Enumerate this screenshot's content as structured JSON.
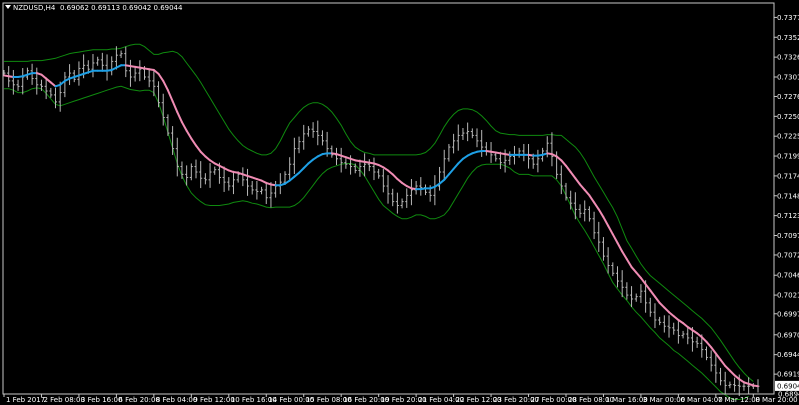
{
  "window": {
    "symbol_label": "NZDUSD,H4",
    "ohlc_label": "0.69062 0.69113 0.69042 0.69044"
  },
  "chart_data": {
    "type": "candlestick",
    "ylim": [
      0.6894,
      0.7396
    ],
    "y_ticks": [
      0.73775,
      0.7352,
      0.73265,
      0.7301,
      0.7276,
      0.72505,
      0.7225,
      0.71995,
      0.7174,
      0.71485,
      0.7123,
      0.70975,
      0.70725,
      0.70465,
      0.7021,
      0.6997,
      0.697,
      0.69445,
      0.69195
    ],
    "current_price": 0.69044,
    "marker_price": 0.6894,
    "x_labels": [
      "1 Feb 2017",
      "2 Feb 08:00",
      "3 Feb 16:00",
      "6 Feb 20:00",
      "8 Feb 04:00",
      "9 Feb 12:00",
      "10 Feb 16:00",
      "14 Feb 00:00",
      "15 Feb 08:00",
      "16 Feb 20:00",
      "19 Feb 20:00",
      "21 Feb 04:00",
      "22 Feb 12:00",
      "23 Feb 20:00",
      "27 Feb 00:00",
      "28 Feb 08:00",
      "1 Mar 16:00",
      "3 Mar 00:00",
      "6 Mar 04:00",
      "7 Mar 12:00",
      "8 Mar 20:00"
    ],
    "x_label_bars": [
      0,
      8,
      16,
      24,
      32,
      40,
      48,
      56,
      64,
      72,
      80,
      88,
      96,
      104,
      112,
      120,
      128,
      136,
      144,
      152,
      160
    ],
    "close": [
      0.7306,
      0.7296,
      0.7291,
      0.7289,
      0.7301,
      0.7309,
      0.7299,
      0.7291,
      0.7289,
      0.7283,
      0.7278,
      0.7269,
      0.7281,
      0.7301,
      0.7306,
      0.7298,
      0.7312,
      0.7316,
      0.7311,
      0.7319,
      0.7323,
      0.7316,
      0.7309,
      0.7321,
      0.7329,
      0.7331,
      0.7309,
      0.7301,
      0.7306,
      0.7311,
      0.7301,
      0.7296,
      0.7289,
      0.7268,
      0.7249,
      0.7229,
      0.7209,
      0.7186,
      0.7176,
      0.7172,
      0.7186,
      0.7179,
      0.7171,
      0.7169,
      0.7179,
      0.7182,
      0.7172,
      0.7166,
      0.7161,
      0.7169,
      0.7176,
      0.7169,
      0.7161,
      0.7156,
      0.7154,
      0.7156,
      0.7146,
      0.7152,
      0.7161,
      0.7166,
      0.7176,
      0.7189,
      0.7209,
      0.7218,
      0.7228,
      0.7234,
      0.7231,
      0.7226,
      0.7219,
      0.7209,
      0.7201,
      0.7196,
      0.7191,
      0.7189,
      0.7186,
      0.7181,
      0.7186,
      0.7189,
      0.7186,
      0.7179,
      0.7174,
      0.7161,
      0.7151,
      0.7141,
      0.7136,
      0.7141,
      0.7149,
      0.7156,
      0.7161,
      0.7159,
      0.7153,
      0.7149,
      0.7161,
      0.7179,
      0.7196,
      0.7211,
      0.7219,
      0.7226,
      0.7229,
      0.7231,
      0.7226,
      0.7219,
      0.7211,
      0.7206,
      0.7201,
      0.7196,
      0.7191,
      0.7194,
      0.7199,
      0.7201,
      0.7206,
      0.7201,
      0.7196,
      0.7189,
      0.7196,
      0.7206,
      0.7216,
      0.7199,
      0.7176,
      0.7161,
      0.7146,
      0.7139,
      0.7131,
      0.7126,
      0.7131,
      0.7119,
      0.7101,
      0.7089,
      0.7071,
      0.7059,
      0.7049,
      0.7039,
      0.7031,
      0.7021,
      0.7016,
      0.7019,
      0.7026,
      0.7011,
      0.6999,
      0.6989,
      0.6986,
      0.6981,
      0.6979,
      0.6976,
      0.6969,
      0.6971,
      0.6966,
      0.6961,
      0.6959,
      0.6951,
      0.6941,
      0.6931,
      0.6921,
      0.6911,
      0.6905,
      0.6906,
      0.6905,
      0.6904,
      0.6904,
      0.6904,
      0.6904,
      0.6904
    ],
    "ma": [
      0.7303,
      0.7302,
      0.7301,
      0.7301,
      0.7302,
      0.7304,
      0.7306,
      0.7306,
      0.7304,
      0.7299,
      0.7294,
      0.7289,
      0.7291,
      0.7296,
      0.7299,
      0.7301,
      0.7303,
      0.7305,
      0.7307,
      0.7309,
      0.7309,
      0.7309,
      0.7309,
      0.731,
      0.7313,
      0.7316,
      0.7316,
      0.7315,
      0.7314,
      0.7313,
      0.7312,
      0.7311,
      0.731,
      0.7305,
      0.7296,
      0.7284,
      0.727,
      0.7256,
      0.7243,
      0.7232,
      0.7222,
      0.7213,
      0.7205,
      0.7199,
      0.7194,
      0.719,
      0.7187,
      0.7184,
      0.7181,
      0.7179,
      0.7178,
      0.7176,
      0.7174,
      0.7172,
      0.717,
      0.7168,
      0.7165,
      0.7163,
      0.7162,
      0.7162,
      0.7164,
      0.7168,
      0.7173,
      0.7178,
      0.7184,
      0.719,
      0.7195,
      0.7199,
      0.7202,
      0.7203,
      0.7203,
      0.7202,
      0.72,
      0.7198,
      0.7196,
      0.7194,
      0.7193,
      0.7192,
      0.7191,
      0.719,
      0.7188,
      0.7185,
      0.7181,
      0.7176,
      0.717,
      0.7165,
      0.7161,
      0.7158,
      0.7157,
      0.7157,
      0.7158,
      0.7158,
      0.716,
      0.7164,
      0.7169,
      0.7176,
      0.7183,
      0.719,
      0.7196,
      0.72,
      0.7203,
      0.7205,
      0.7206,
      0.7206,
      0.7205,
      0.7204,
      0.7203,
      0.7202,
      0.7201,
      0.7201,
      0.7201,
      0.7201,
      0.7201,
      0.72,
      0.72,
      0.7201,
      0.7203,
      0.7202,
      0.7199,
      0.7194,
      0.7187,
      0.7179,
      0.7171,
      0.7163,
      0.7156,
      0.7149,
      0.714,
      0.7131,
      0.7121,
      0.711,
      0.7099,
      0.7088,
      0.7077,
      0.7067,
      0.7057,
      0.705,
      0.7043,
      0.7035,
      0.7027,
      0.7019,
      0.7011,
      0.7005,
      0.6999,
      0.6994,
      0.6989,
      0.6985,
      0.698,
      0.6976,
      0.6972,
      0.6967,
      0.6961,
      0.6954,
      0.6946,
      0.6938,
      0.693,
      0.6924,
      0.6918,
      0.6913,
      0.6909,
      0.6907,
      0.6905,
      0.6904
    ],
    "upper_band": [
      0.7321,
      0.7321,
      0.7321,
      0.7321,
      0.7321,
      0.7321,
      0.7322,
      0.7322,
      0.7322,
      0.7323,
      0.7324,
      0.7325,
      0.7327,
      0.7329,
      0.7331,
      0.7332,
      0.7333,
      0.7334,
      0.7335,
      0.7336,
      0.7336,
      0.7336,
      0.7336,
      0.7337,
      0.7337,
      0.7338,
      0.734,
      0.7342,
      0.7343,
      0.7343,
      0.734,
      0.7335,
      0.733,
      0.733,
      0.7332,
      0.7333,
      0.7334,
      0.7332,
      0.7327,
      0.7319,
      0.7311,
      0.7303,
      0.7294,
      0.7284,
      0.7274,
      0.7264,
      0.7254,
      0.7244,
      0.7234,
      0.7226,
      0.7219,
      0.7213,
      0.7209,
      0.7206,
      0.7203,
      0.7201,
      0.7201,
      0.7203,
      0.7209,
      0.7219,
      0.7231,
      0.7242,
      0.7249,
      0.7256,
      0.7262,
      0.7266,
      0.7268,
      0.7268,
      0.7266,
      0.7262,
      0.7256,
      0.7248,
      0.7239,
      0.7228,
      0.7218,
      0.7211,
      0.7207,
      0.7204,
      0.7203,
      0.7201,
      0.7201,
      0.7201,
      0.7201,
      0.7201,
      0.7201,
      0.7201,
      0.7201,
      0.7201,
      0.7201,
      0.7202,
      0.7204,
      0.7209,
      0.7216,
      0.7226,
      0.7237,
      0.7246,
      0.7253,
      0.7258,
      0.726,
      0.726,
      0.7259,
      0.7256,
      0.7251,
      0.7245,
      0.7238,
      0.7232,
      0.7229,
      0.7228,
      0.7227,
      0.7227,
      0.7226,
      0.7226,
      0.7226,
      0.7226,
      0.7226,
      0.7226,
      0.7227,
      0.7227,
      0.7226,
      0.7226,
      0.7221,
      0.7216,
      0.7211,
      0.7204,
      0.7195,
      0.7184,
      0.7173,
      0.7163,
      0.7153,
      0.7143,
      0.7133,
      0.7121,
      0.7106,
      0.7091,
      0.7081,
      0.7071,
      0.7061,
      0.7053,
      0.7046,
      0.7041,
      0.7036,
      0.7031,
      0.7026,
      0.7021,
      0.7016,
      0.7011,
      0.7006,
      0.7001,
      0.6996,
      0.6991,
      0.6985,
      0.6979,
      0.6971,
      0.6963,
      0.6954,
      0.6945,
      0.6936,
      0.6928,
      0.6921,
      0.6915,
      0.691
    ],
    "lower_band": [
      0.7286,
      0.7286,
      0.7284,
      0.7281,
      0.7281,
      0.7283,
      0.7286,
      0.7287,
      0.7286,
      0.728,
      0.7273,
      0.7266,
      0.7264,
      0.7266,
      0.7268,
      0.727,
      0.7272,
      0.7274,
      0.7276,
      0.7278,
      0.728,
      0.7282,
      0.7284,
      0.7286,
      0.7288,
      0.7289,
      0.7287,
      0.7285,
      0.7284,
      0.7283,
      0.7284,
      0.7284,
      0.7281,
      0.7268,
      0.725,
      0.723,
      0.721,
      0.719,
      0.7174,
      0.7162,
      0.7152,
      0.7146,
      0.7141,
      0.7137,
      0.7136,
      0.7136,
      0.7136,
      0.7137,
      0.7138,
      0.714,
      0.7141,
      0.7142,
      0.7141,
      0.7139,
      0.7138,
      0.7136,
      0.7134,
      0.7133,
      0.7134,
      0.7134,
      0.7134,
      0.7134,
      0.7136,
      0.714,
      0.7146,
      0.7154,
      0.7162,
      0.717,
      0.7177,
      0.7182,
      0.7185,
      0.7187,
      0.7189,
      0.719,
      0.719,
      0.7188,
      0.7182,
      0.7174,
      0.7164,
      0.7154,
      0.7144,
      0.7136,
      0.7131,
      0.7126,
      0.7122,
      0.7119,
      0.7119,
      0.7121,
      0.7124,
      0.7124,
      0.7122,
      0.7119,
      0.7119,
      0.7121,
      0.7124,
      0.7131,
      0.7141,
      0.7151,
      0.7161,
      0.7171,
      0.7179,
      0.7185,
      0.7188,
      0.7189,
      0.7189,
      0.7189,
      0.7189,
      0.7187,
      0.7184,
      0.7179,
      0.7176,
      0.7176,
      0.7176,
      0.7174,
      0.7174,
      0.7174,
      0.7174,
      0.7174,
      0.7169,
      0.7161,
      0.7149,
      0.7136,
      0.7123,
      0.7113,
      0.7104,
      0.7094,
      0.7083,
      0.7072,
      0.7061,
      0.7049,
      0.7037,
      0.7029,
      0.7021,
      0.7014,
      0.7006,
      0.6999,
      0.6993,
      0.6986,
      0.6979,
      0.6973,
      0.6966,
      0.6961,
      0.6956,
      0.695,
      0.6946,
      0.6941,
      0.6936,
      0.6931,
      0.6926,
      0.6921,
      0.6915,
      0.6909,
      0.6903,
      0.6897,
      0.6893,
      0.6889,
      0.6887,
      0.6887,
      0.6888,
      0.6891
    ],
    "colors": {
      "background": "#000000",
      "bars": "#b8b8b8",
      "bands": "#0f8a0f",
      "ma_rising": "#1ea0e6",
      "ma_falling": "#f08cb4",
      "axis": "#c8c8c8",
      "text": "#ffffff"
    }
  }
}
